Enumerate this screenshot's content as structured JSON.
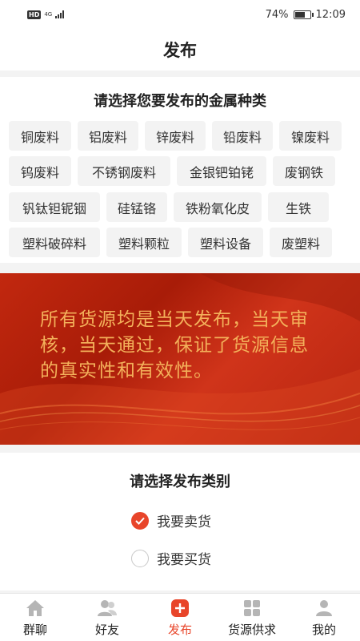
{
  "status_bar": {
    "hd": "HD",
    "network": "4G",
    "battery": "74%",
    "battery_level": 0.74,
    "time": "12:09"
  },
  "header": {
    "title": "发布"
  },
  "metal_section": {
    "title": "请选择您要发布的金属种类",
    "rows": [
      [
        "铜废料",
        "铝废料",
        "锌废料",
        "铅废料",
        "镍废料"
      ],
      [
        "钨废料",
        "不锈钢废料",
        "金银钯铂铑",
        "废钢铁"
      ],
      [
        "钒钛钽铌铟",
        "硅锰铬",
        "铁粉氧化皮",
        "生铁"
      ],
      [
        "塑料破碎料",
        "塑料颗粒",
        "塑料设备",
        "废塑料"
      ]
    ]
  },
  "banner": {
    "text": "所有货源均是当天发布，当天审核，当天通过，保证了货源信息的真实性和有效性。"
  },
  "type_section": {
    "title": "请选择发布类别",
    "options": [
      {
        "label": "我要卖货",
        "checked": true
      },
      {
        "label": "我要买货",
        "checked": false
      }
    ]
  },
  "tabbar": {
    "tabs": [
      {
        "label": "群聊",
        "icon": "home-icon",
        "active": false
      },
      {
        "label": "好友",
        "icon": "friends-icon",
        "active": false
      },
      {
        "label": "发布",
        "icon": "publish-plus-icon",
        "active": true
      },
      {
        "label": "货源供求",
        "icon": "grid-icon",
        "active": false
      },
      {
        "label": "我的",
        "icon": "person-icon",
        "active": false
      }
    ]
  },
  "colors": {
    "accent": "#e8452a",
    "banner_red": "#c2280f",
    "banner_text": "#f3b05a",
    "icon_gray": "#b5b5b5"
  }
}
